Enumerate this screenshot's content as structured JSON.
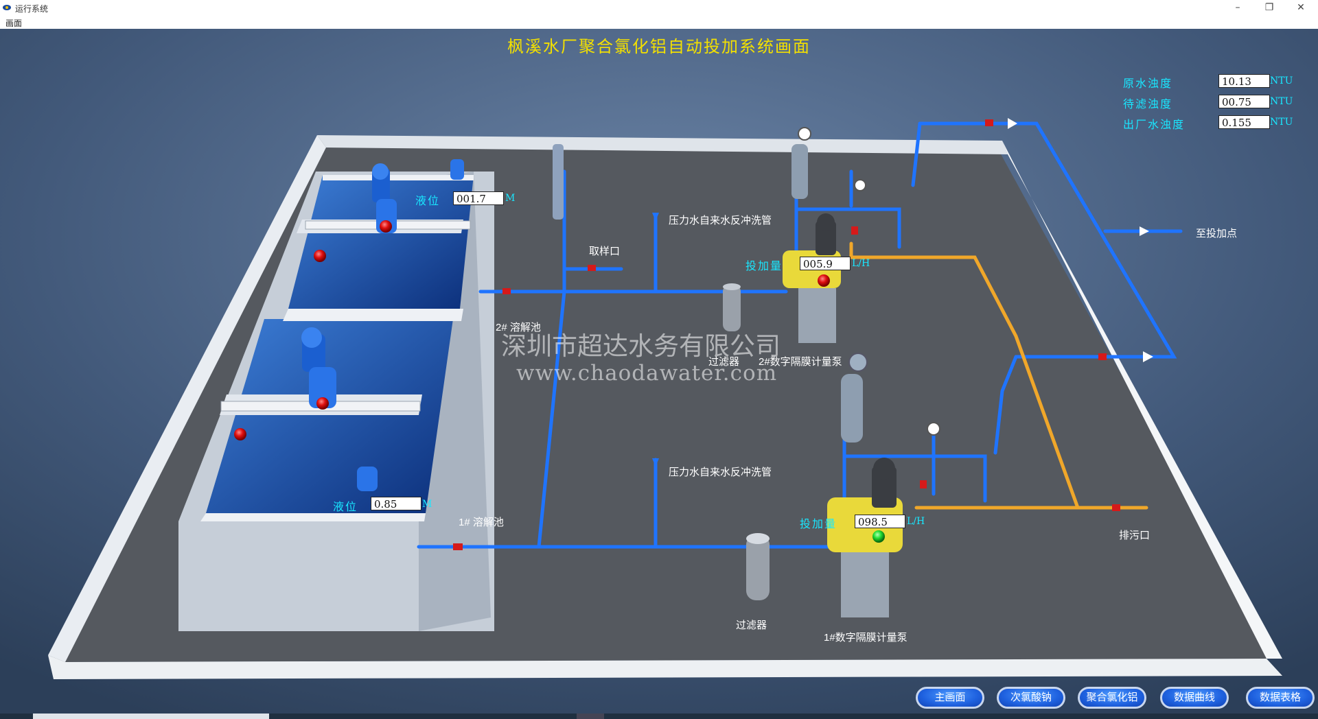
{
  "window": {
    "title": "运行系统",
    "minimize": "–",
    "restore": "❐",
    "close": "✕"
  },
  "menu": {
    "items": [
      "画面"
    ]
  },
  "screen": {
    "title": "枫溪水厂聚合氯化铝自动投加系统画面"
  },
  "turbidity": [
    {
      "label": "原水浊度",
      "value": "10.13",
      "unit": "NTU"
    },
    {
      "label": "待滤浊度",
      "value": "00.75",
      "unit": "NTU"
    },
    {
      "label": "出厂水浊度",
      "value": "0.155",
      "unit": "NTU"
    }
  ],
  "tanks": {
    "tank2": {
      "level_label": "液位",
      "level_value": "001.7",
      "unit": "M",
      "name": "2# 溶解池"
    },
    "tank1": {
      "level_label": "液位",
      "level_value": "0.85",
      "unit": "M",
      "name": "1# 溶解池"
    }
  },
  "pumps": {
    "pump2": {
      "flow_label": "投加量",
      "flow_value": "005.9",
      "unit": "L/H",
      "name": "2#数字隔膜计量泵",
      "status": "stopped"
    },
    "pump1": {
      "flow_label": "投加量",
      "flow_value": "098.5",
      "unit": "L/H",
      "name": "1#数字隔膜计量泵",
      "status": "running"
    }
  },
  "labels": {
    "backwash_top": "压力水自来水反冲洗管",
    "backwash_bottom": "压力水自来水反冲洗管",
    "sample_port": "取样口",
    "filter_top": "过滤器",
    "filter_bottom": "过滤器",
    "to_dosing_point": "至投加点",
    "drain": "排污口"
  },
  "watermark": {
    "line1": "深圳市超达水务有限公司",
    "line2": "www.chaodawater.com"
  },
  "nav": [
    "主画面",
    "次氯酸钠",
    "聚合氯化铝",
    "数据曲线",
    "数据表格"
  ],
  "colors": {
    "title_yellow": "#f3e000",
    "label_cyan": "#19e7ff",
    "pipe_blue": "#1f74ff",
    "pipe_orange": "#f0a72a",
    "pump_yellow": "#e9d93a",
    "status_running": "#22dd33",
    "status_stopped": "#e01010"
  },
  "icons": [
    "app-icon",
    "motor-icon",
    "gauge-icon",
    "valve-icon",
    "status-lamp-icon"
  ]
}
